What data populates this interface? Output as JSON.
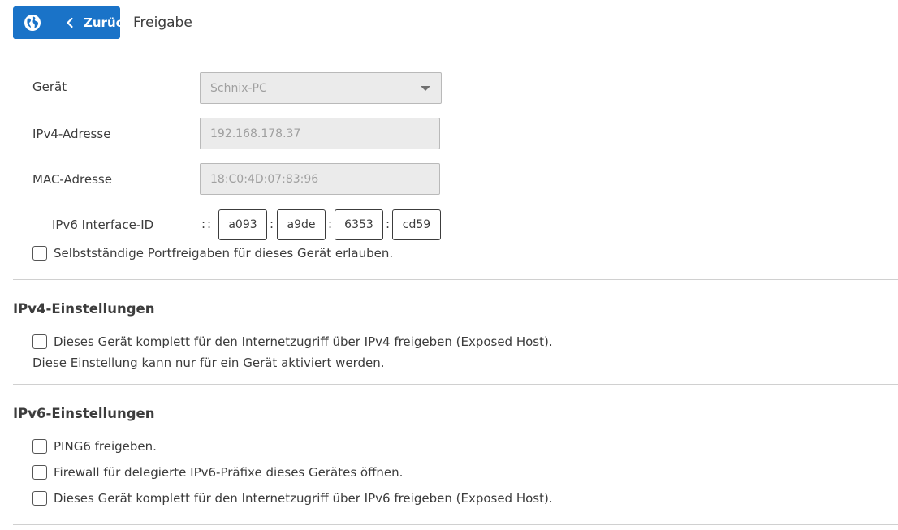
{
  "header": {
    "back_label": "Zurück",
    "title": "Freigabe",
    "back_icon": "globe-icon",
    "chevron_icon": "chevron-left-icon",
    "accent_color": "#1a73c8"
  },
  "form": {
    "device_label": "Gerät",
    "device_value": "Schnix-PC",
    "ipv4_label": "IPv4-Adresse",
    "ipv4_value": "192.168.178.37",
    "mac_label": "MAC-Adresse",
    "mac_value": "18:C0:4D:07:83:96",
    "ipv6_label": "IPv6 Interface-ID",
    "ipv6_prefix": "::",
    "ipv6_parts": [
      "a093",
      "a9de",
      "6353",
      "cd59"
    ],
    "ipv6_separator": ":",
    "port_forwarding_label": "Selbstständige Portfreigaben für dieses Gerät erlauben.",
    "port_forwarding_checked": false
  },
  "ipv4_section": {
    "title": "IPv4-Einstellungen",
    "exposed_host_label": "Dieses Gerät komplett für den Internetzugriff über IPv4 freigeben (Exposed Host).",
    "exposed_host_checked": false,
    "note": "Diese Einstellung kann nur für ein Gerät aktiviert werden."
  },
  "ipv6_section": {
    "title": "IPv6-Einstellungen",
    "ping6_label": "PING6 freigeben.",
    "ping6_checked": false,
    "firewall_label": "Firewall für delegierte IPv6-Präfixe dieses Gerätes öffnen.",
    "firewall_checked": false,
    "exposed_host_label": "Dieses Gerät komplett für den Internetzugriff über IPv6 freigeben (Exposed Host).",
    "exposed_host_checked": false
  }
}
